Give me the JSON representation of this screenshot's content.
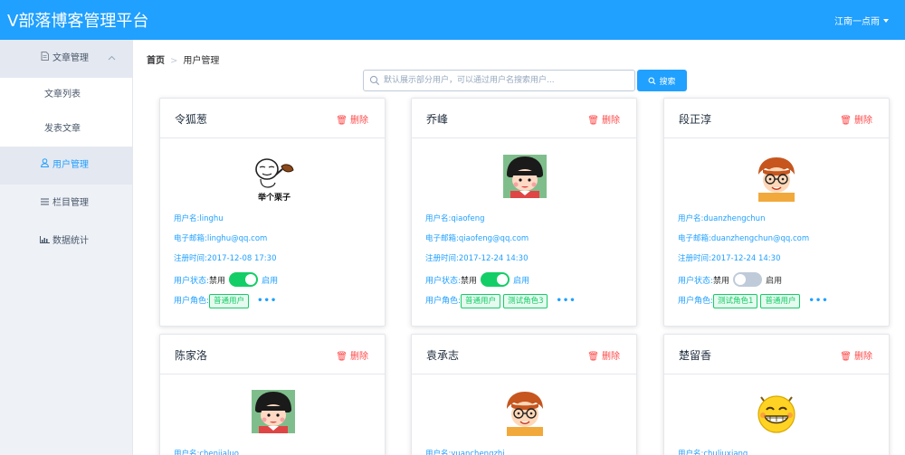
{
  "header": {
    "brand": "V部落博客管理平台",
    "user": "江南一点雨"
  },
  "sidebar": {
    "group": {
      "label": "文章管理",
      "icon": "document-icon"
    },
    "sub_items": [
      {
        "label": "文章列表"
      },
      {
        "label": "发表文章"
      }
    ],
    "items": [
      {
        "label": "用户管理",
        "icon": "user-icon",
        "active": true
      },
      {
        "label": "栏目管理",
        "icon": "list-icon"
      },
      {
        "label": "数据统计",
        "icon": "bar-chart-icon"
      }
    ]
  },
  "breadcrumb": {
    "home": "首页",
    "current": "用户管理"
  },
  "search": {
    "placeholder": "默认展示部分用户，可以通过用户名搜索用户...",
    "button_label": "搜索"
  },
  "delete_label": "删除",
  "labels": {
    "username": "用户名:",
    "email": "电子邮箱:",
    "registered": "注册时间:",
    "status": "用户状态:",
    "disabled": "禁用",
    "enabled": "启用",
    "roles": "用户角色:",
    "more": "•••"
  },
  "avatar_caption": "举个栗子",
  "users": [
    {
      "name": "令狐葱",
      "username": "linghu",
      "email": "linghu@qq.com",
      "registered": "2017-12-08 17:30",
      "enabled": true,
      "roles": [
        "普通用户"
      ]
    },
    {
      "name": "乔峰",
      "username": "qiaofeng",
      "email": "qiaofeng@qq.com",
      "registered": "2017-12-24 14:30",
      "enabled": true,
      "roles": [
        "普通用户",
        "测试角色3"
      ]
    },
    {
      "name": "段正淳",
      "username": "duanzhengchun",
      "email": "duanzhengchun@qq.com",
      "registered": "2017-12-24 14:30",
      "enabled": false,
      "roles": [
        "测试角色1",
        "普通用户"
      ]
    },
    {
      "name": "陈家洛",
      "username": "chenjialuo"
    },
    {
      "name": "袁承志",
      "username": "yuanchengzhi"
    },
    {
      "name": "楚留香",
      "username": "chuliuxiang"
    }
  ],
  "colors": {
    "primary": "#20a0ff",
    "success": "#13ce66",
    "danger": "#ff4949",
    "sidebar_bg": "#eef1f6"
  }
}
